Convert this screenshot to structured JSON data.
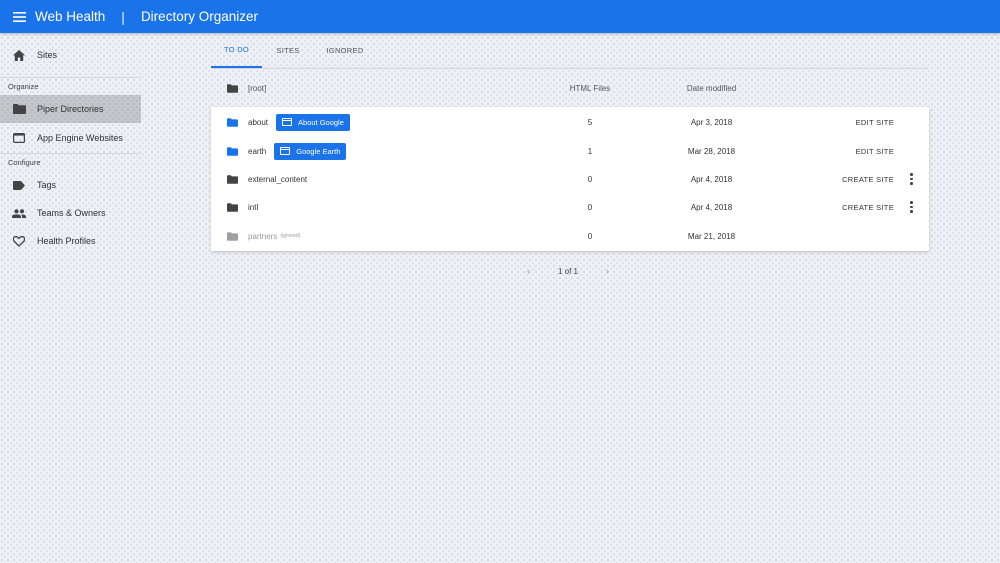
{
  "appbar": {
    "app_title": "Web Health",
    "separator": "|",
    "page_title": "Directory Organizer"
  },
  "sidebar": {
    "top_item": {
      "label": "Sites",
      "icon": "home-icon"
    },
    "organize_label": "Organize",
    "organize_items": [
      {
        "label": "Piper Directories",
        "icon": "folder-icon",
        "active": true
      },
      {
        "label": "App Engine Websites",
        "icon": "browser-window-icon",
        "active": false
      }
    ],
    "configure_label": "Configure",
    "configure_items": [
      {
        "label": "Tags",
        "icon": "tag-icon"
      },
      {
        "label": "Teams & Owners",
        "icon": "people-icon"
      },
      {
        "label": "Health Profiles",
        "icon": "heart-icon"
      }
    ]
  },
  "tabs": [
    {
      "label": "TO DO",
      "active": true
    },
    {
      "label": "SITES",
      "active": false
    },
    {
      "label": "IGNORED",
      "active": false
    }
  ],
  "table": {
    "root_label": "[root]",
    "col_files": "HTML Files",
    "col_date": "Date modified",
    "rows": [
      {
        "name": "about",
        "chip": "About Google",
        "files": "5",
        "date": "Apr 3, 2018",
        "action": "EDIT SITE"
      },
      {
        "name": "earth",
        "chip": "Google Earth",
        "files": "1",
        "date": "Mar 28, 2018",
        "action": "EDIT SITE"
      },
      {
        "name": "external_content",
        "chip": "",
        "files": "0",
        "date": "Apr 4, 2018",
        "action": "CREATE SITE"
      },
      {
        "name": "intl",
        "chip": "",
        "files": "0",
        "date": "Apr 4, 2018",
        "action": "CREATE SITE"
      },
      {
        "name": "partners",
        "tag": "(ignored)",
        "files": "0",
        "date": "Mar 21, 2018",
        "action": ""
      }
    ]
  },
  "pager": {
    "prev": "‹",
    "text": "1 of 1",
    "next": "›"
  },
  "colors": {
    "primary": "#1a73e8",
    "folder_blue": "#1a73e8",
    "folder_dark": "#444444",
    "folder_grey": "#a0a0a0"
  }
}
